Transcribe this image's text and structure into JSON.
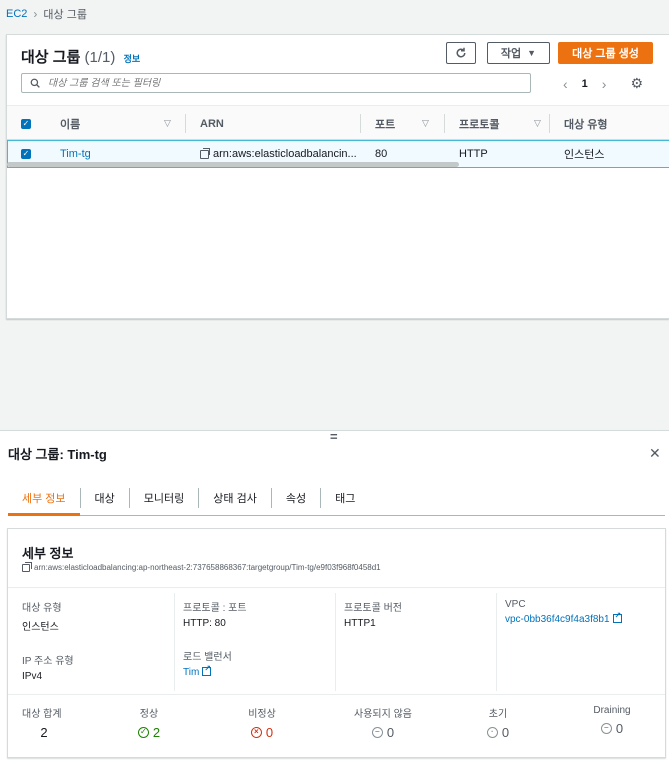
{
  "breadcrumb": {
    "root": "EC2",
    "current": "대상 그룹"
  },
  "panel": {
    "title": "대상 그룹",
    "count": "(1/1)",
    "info": "정보",
    "actions_label": "작업",
    "create_label": "대상 그룹 생성",
    "search_placeholder": "대상 그룹 검색 또는 필터링",
    "page": "1"
  },
  "table": {
    "columns": [
      "이름",
      "ARN",
      "포트",
      "프로토콜",
      "대상 유형"
    ],
    "rows": [
      {
        "name": "Tim-tg",
        "arn": "arn:aws:elasticloadbalancin...",
        "port": "80",
        "protocol": "HTTP",
        "target_type": "인스턴스"
      }
    ]
  },
  "split": {
    "title": "대상 그룹: Tim-tg",
    "tabs": [
      "세부 정보",
      "대상",
      "모니터링",
      "상태 검사",
      "속성",
      "태그"
    ],
    "details": {
      "title": "세부 정보",
      "arn": "arn:aws:elasticloadbalancing:ap-northeast-2:737658868367:targetgroup/Tim-tg/e9f03f968f0458d1",
      "fields": {
        "target_type_label": "대상 유형",
        "target_type": "인스턴스",
        "ip_type_label": "IP 주소 유형",
        "ip_type": "IPv4",
        "protocol_port_label": "프로토콜 : 포트",
        "protocol_port": "HTTP: 80",
        "lb_label": "로드 밸런서",
        "lb": "Tim",
        "protocol_version_label": "프로토콜 버전",
        "protocol_version": "HTTP1",
        "vpc_label": "VPC",
        "vpc": "vpc-0bb36f4c9f4a3f8b1"
      },
      "stats": [
        {
          "label": "대상 합계",
          "value": "2"
        },
        {
          "label": "정상",
          "value": "2"
        },
        {
          "label": "비정상",
          "value": "0"
        },
        {
          "label": "사용되지 않음",
          "value": "0"
        },
        {
          "label": "초기",
          "value": "0"
        },
        {
          "label": "Draining",
          "value": "0"
        }
      ]
    }
  },
  "colors": {
    "accent": "#ec7211",
    "link": "#0073bb",
    "healthy": "#1d8102",
    "unhealthy": "#d13212",
    "neutral": "#687078"
  }
}
